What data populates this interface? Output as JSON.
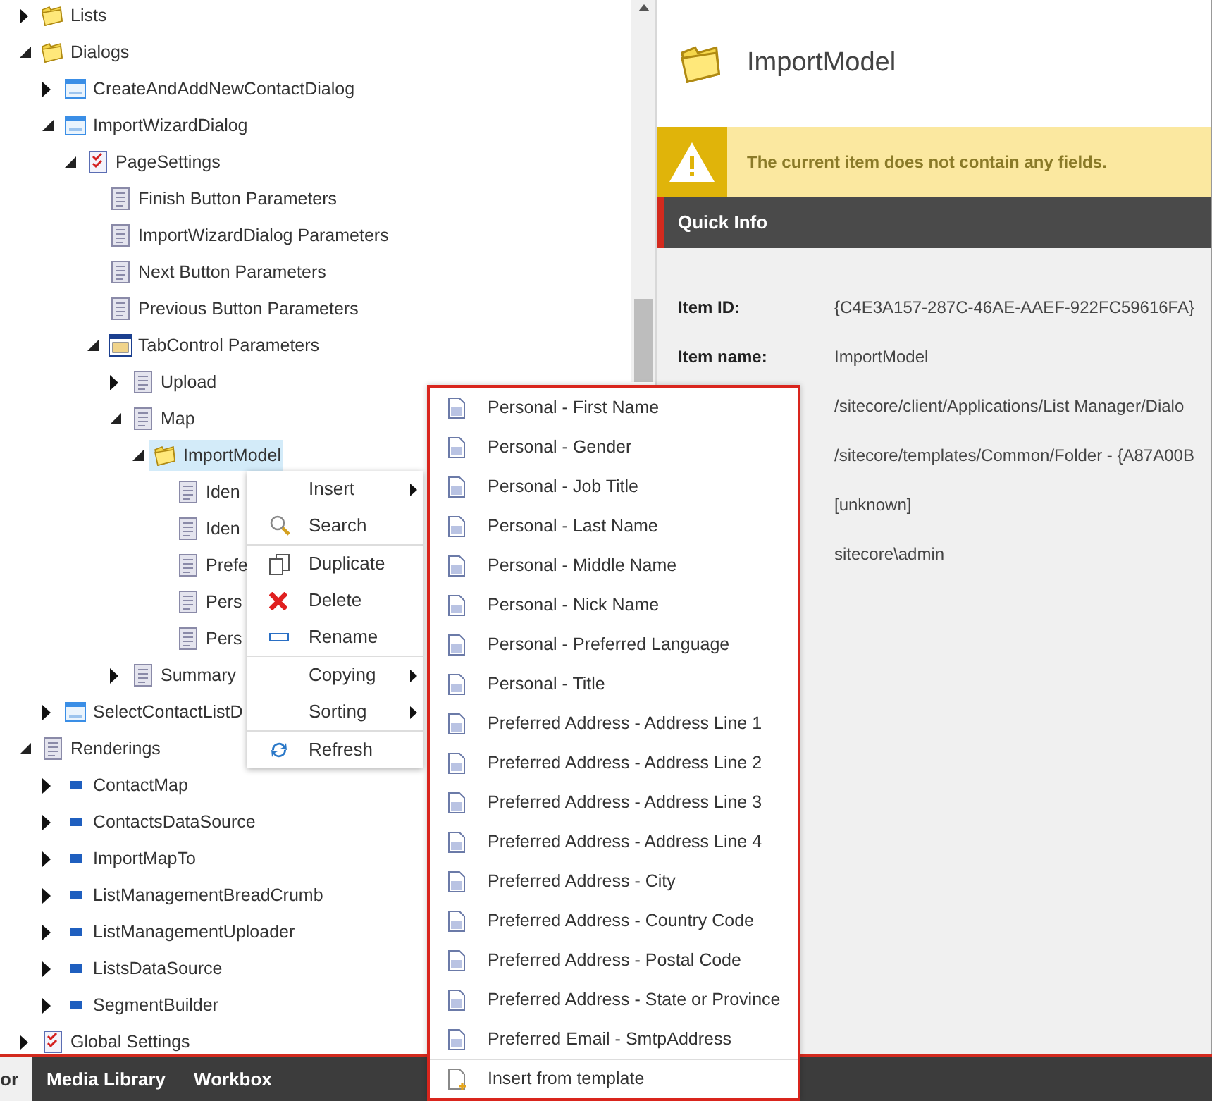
{
  "tree": [
    {
      "label": "Lists",
      "kind": "folder",
      "expandable": true,
      "expanded": false,
      "selected": false
    },
    {
      "label": "Dialogs",
      "kind": "folder",
      "expandable": true,
      "expanded": true,
      "selected": false,
      "children": [
        {
          "label": "CreateAndAddNewContactDialog",
          "kind": "dialog",
          "expandable": true,
          "expanded": false,
          "selected": false
        },
        {
          "label": "ImportWizardDialog",
          "kind": "dialog",
          "expandable": true,
          "expanded": true,
          "selected": false,
          "children": [
            {
              "label": "PageSettings",
              "kind": "settings",
              "expandable": true,
              "expanded": true,
              "selected": false,
              "children": [
                {
                  "label": "Finish Button Parameters",
                  "kind": "params",
                  "expandable": false,
                  "selected": false
                },
                {
                  "label": "ImportWizardDialog Parameters",
                  "kind": "params",
                  "expandable": false,
                  "selected": false
                },
                {
                  "label": "Next Button Parameters",
                  "kind": "params",
                  "expandable": false,
                  "selected": false
                },
                {
                  "label": "Previous Button Parameters",
                  "kind": "params",
                  "expandable": false,
                  "selected": false
                },
                {
                  "label": "TabControl Parameters",
                  "kind": "tabcontrol",
                  "expandable": true,
                  "expanded": true,
                  "selected": false,
                  "children": [
                    {
                      "label": "Upload",
                      "kind": "params",
                      "expandable": true,
                      "expanded": false,
                      "selected": false
                    },
                    {
                      "label": "Map",
                      "kind": "params",
                      "expandable": true,
                      "expanded": true,
                      "selected": false,
                      "children": [
                        {
                          "label": "ImportModel",
                          "kind": "folder",
                          "expandable": true,
                          "expanded": true,
                          "selected": true,
                          "children": [
                            {
                              "label": "Iden",
                              "kind": "params",
                              "expandable": false,
                              "selected": false
                            },
                            {
                              "label": "Iden",
                              "kind": "params",
                              "expandable": false,
                              "selected": false
                            },
                            {
                              "label": "Prefe",
                              "kind": "params",
                              "expandable": false,
                              "selected": false
                            },
                            {
                              "label": "Pers",
                              "kind": "params",
                              "expandable": false,
                              "selected": false
                            },
                            {
                              "label": "Pers",
                              "kind": "params",
                              "expandable": false,
                              "selected": false
                            }
                          ]
                        }
                      ]
                    },
                    {
                      "label": "Summary",
                      "kind": "params",
                      "expandable": true,
                      "expanded": false,
                      "selected": false
                    }
                  ]
                }
              ]
            }
          ]
        },
        {
          "label": "SelectContactListD",
          "kind": "dialog",
          "expandable": true,
          "expanded": false,
          "selected": false
        }
      ]
    },
    {
      "label": "Renderings",
      "kind": "params",
      "expandable": true,
      "expanded": true,
      "selected": false,
      "children": [
        {
          "label": "ContactMap",
          "kind": "rendering",
          "expandable": true,
          "expanded": false,
          "selected": false
        },
        {
          "label": "ContactsDataSource",
          "kind": "rendering",
          "expandable": true,
          "expanded": false,
          "selected": false
        },
        {
          "label": "ImportMapTo",
          "kind": "rendering",
          "expandable": true,
          "expanded": false,
          "selected": false
        },
        {
          "label": "ListManagementBreadCrumb",
          "kind": "rendering",
          "expandable": true,
          "expanded": false,
          "selected": false
        },
        {
          "label": "ListManagementUploader",
          "kind": "rendering",
          "expandable": true,
          "expanded": false,
          "selected": false
        },
        {
          "label": "ListsDataSource",
          "kind": "rendering",
          "expandable": true,
          "expanded": false,
          "selected": false
        },
        {
          "label": "SegmentBuilder",
          "kind": "rendering",
          "expandable": true,
          "expanded": false,
          "selected": false
        }
      ]
    },
    {
      "label": "Global Settings",
      "kind": "settings",
      "expandable": true,
      "expanded": false,
      "selected": false
    }
  ],
  "item": {
    "title": "ImportModel",
    "warning": "The current item does not contain any fields.",
    "section": "Quick Info",
    "rows": [
      {
        "label": "Item ID:",
        "value": "{C4E3A157-287C-46AE-AAEF-922FC59616FA}"
      },
      {
        "label": "Item name:",
        "value": "ImportModel"
      },
      {
        "value": "/sitecore/client/Applications/List Manager/Dialo"
      },
      {
        "value": "/sitecore/templates/Common/Folder - {A87A00B"
      },
      {
        "value": "[unknown]"
      },
      {
        "value": "sitecore\\admin"
      }
    ]
  },
  "context_menu": [
    {
      "kind": "plain",
      "label": "Insert",
      "submenu": true
    },
    {
      "kind": "search",
      "label": "Search",
      "submenu": false
    },
    {
      "kind": "separator"
    },
    {
      "kind": "duplicate",
      "label": "Duplicate",
      "submenu": false
    },
    {
      "kind": "delete",
      "label": "Delete",
      "submenu": false
    },
    {
      "kind": "rename",
      "label": "Rename",
      "submenu": false
    },
    {
      "kind": "separator"
    },
    {
      "kind": "plain",
      "label": "Copying",
      "submenu": true
    },
    {
      "kind": "plain",
      "label": "Sorting",
      "submenu": true
    },
    {
      "kind": "separator"
    },
    {
      "kind": "refresh",
      "label": "Refresh",
      "submenu": false
    }
  ],
  "insert_menu": [
    {
      "kind": "template",
      "label": "Personal - First Name"
    },
    {
      "kind": "template",
      "label": "Personal - Gender"
    },
    {
      "kind": "template",
      "label": "Personal - Job Title"
    },
    {
      "kind": "template",
      "label": "Personal - Last Name"
    },
    {
      "kind": "template",
      "label": "Personal - Middle Name"
    },
    {
      "kind": "template",
      "label": "Personal - Nick Name"
    },
    {
      "kind": "template",
      "label": "Personal - Preferred Language"
    },
    {
      "kind": "template",
      "label": "Personal - Title"
    },
    {
      "kind": "template",
      "label": "Preferred Address - Address Line 1"
    },
    {
      "kind": "template",
      "label": "Preferred Address - Address Line 2"
    },
    {
      "kind": "template",
      "label": "Preferred Address - Address Line 3"
    },
    {
      "kind": "template",
      "label": "Preferred Address - Address Line 4"
    },
    {
      "kind": "template",
      "label": "Preferred Address - City"
    },
    {
      "kind": "template",
      "label": "Preferred Address - Country Code"
    },
    {
      "kind": "template",
      "label": "Preferred Address - Postal Code"
    },
    {
      "kind": "template",
      "label": "Preferred Address - State or Province"
    },
    {
      "kind": "template",
      "label": "Preferred Email - SmtpAddress"
    },
    {
      "kind": "from_template",
      "label": "Insert from template"
    }
  ],
  "bottom_tabs": [
    {
      "label": "or",
      "selected": true
    },
    {
      "label": "Media Library",
      "selected": false
    },
    {
      "label": "Workbox",
      "selected": false
    }
  ]
}
